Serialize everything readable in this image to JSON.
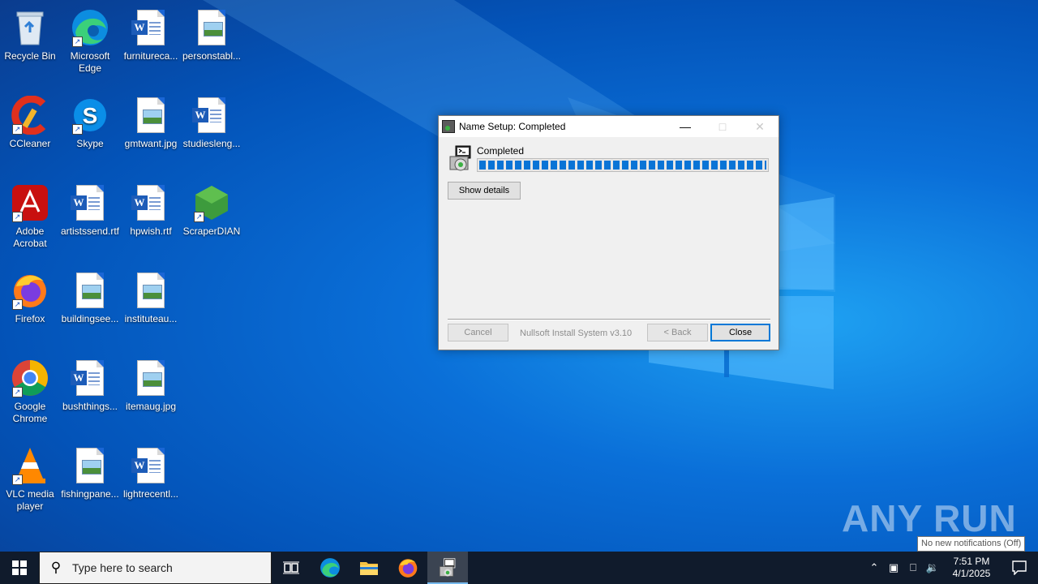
{
  "desktop": {
    "icons": [
      {
        "label": "Recycle Bin",
        "icon": "recycle-bin-icon"
      },
      {
        "label": "Microsoft Edge",
        "icon": "edge-icon"
      },
      {
        "label": "furnitureca...",
        "icon": "word-doc-icon"
      },
      {
        "label": "personstabl...",
        "icon": "image-file-icon"
      },
      {
        "label": "CCleaner",
        "icon": "ccleaner-icon"
      },
      {
        "label": "Skype",
        "icon": "skype-icon"
      },
      {
        "label": "gmtwant.jpg",
        "icon": "image-file-icon"
      },
      {
        "label": "studiesleng...",
        "icon": "word-doc-icon"
      },
      {
        "label": "Adobe Acrobat",
        "icon": "acrobat-icon"
      },
      {
        "label": "artistssend.rtf",
        "icon": "word-doc-icon"
      },
      {
        "label": "hpwish.rtf",
        "icon": "word-doc-icon"
      },
      {
        "label": "ScraperDIAN",
        "icon": "scraper-icon"
      },
      {
        "label": "Firefox",
        "icon": "firefox-icon"
      },
      {
        "label": "buildingsee...",
        "icon": "image-file-icon"
      },
      {
        "label": "instituteau...",
        "icon": "image-file-icon"
      },
      {
        "label": "Google Chrome",
        "icon": "chrome-icon"
      },
      {
        "label": "bushthings...",
        "icon": "word-doc-icon"
      },
      {
        "label": "itemaug.jpg",
        "icon": "image-file-icon"
      },
      {
        "label": "VLC media player",
        "icon": "vlc-icon"
      },
      {
        "label": "fishingpane...",
        "icon": "image-file-icon"
      },
      {
        "label": "lightrecentl...",
        "icon": "word-doc-icon"
      }
    ]
  },
  "dialog": {
    "title": "Name Setup: Completed",
    "status": "Completed",
    "progress_percent": 100,
    "show_details_label": "Show details",
    "cancel_label": "Cancel",
    "branding": "Nullsoft Install System v3.10",
    "back_label": "< Back",
    "close_label": "Close"
  },
  "watermark": {
    "text": "ANY RUN"
  },
  "tooltip": {
    "text": "No new notifications (Off)"
  },
  "taskbar": {
    "search_placeholder": "Type here to search",
    "time": "7:51 PM",
    "date": "4/1/2025"
  },
  "colors": {
    "accent": "#0078d7",
    "progress": "#0a74d6",
    "taskbar": "#101b2c"
  }
}
